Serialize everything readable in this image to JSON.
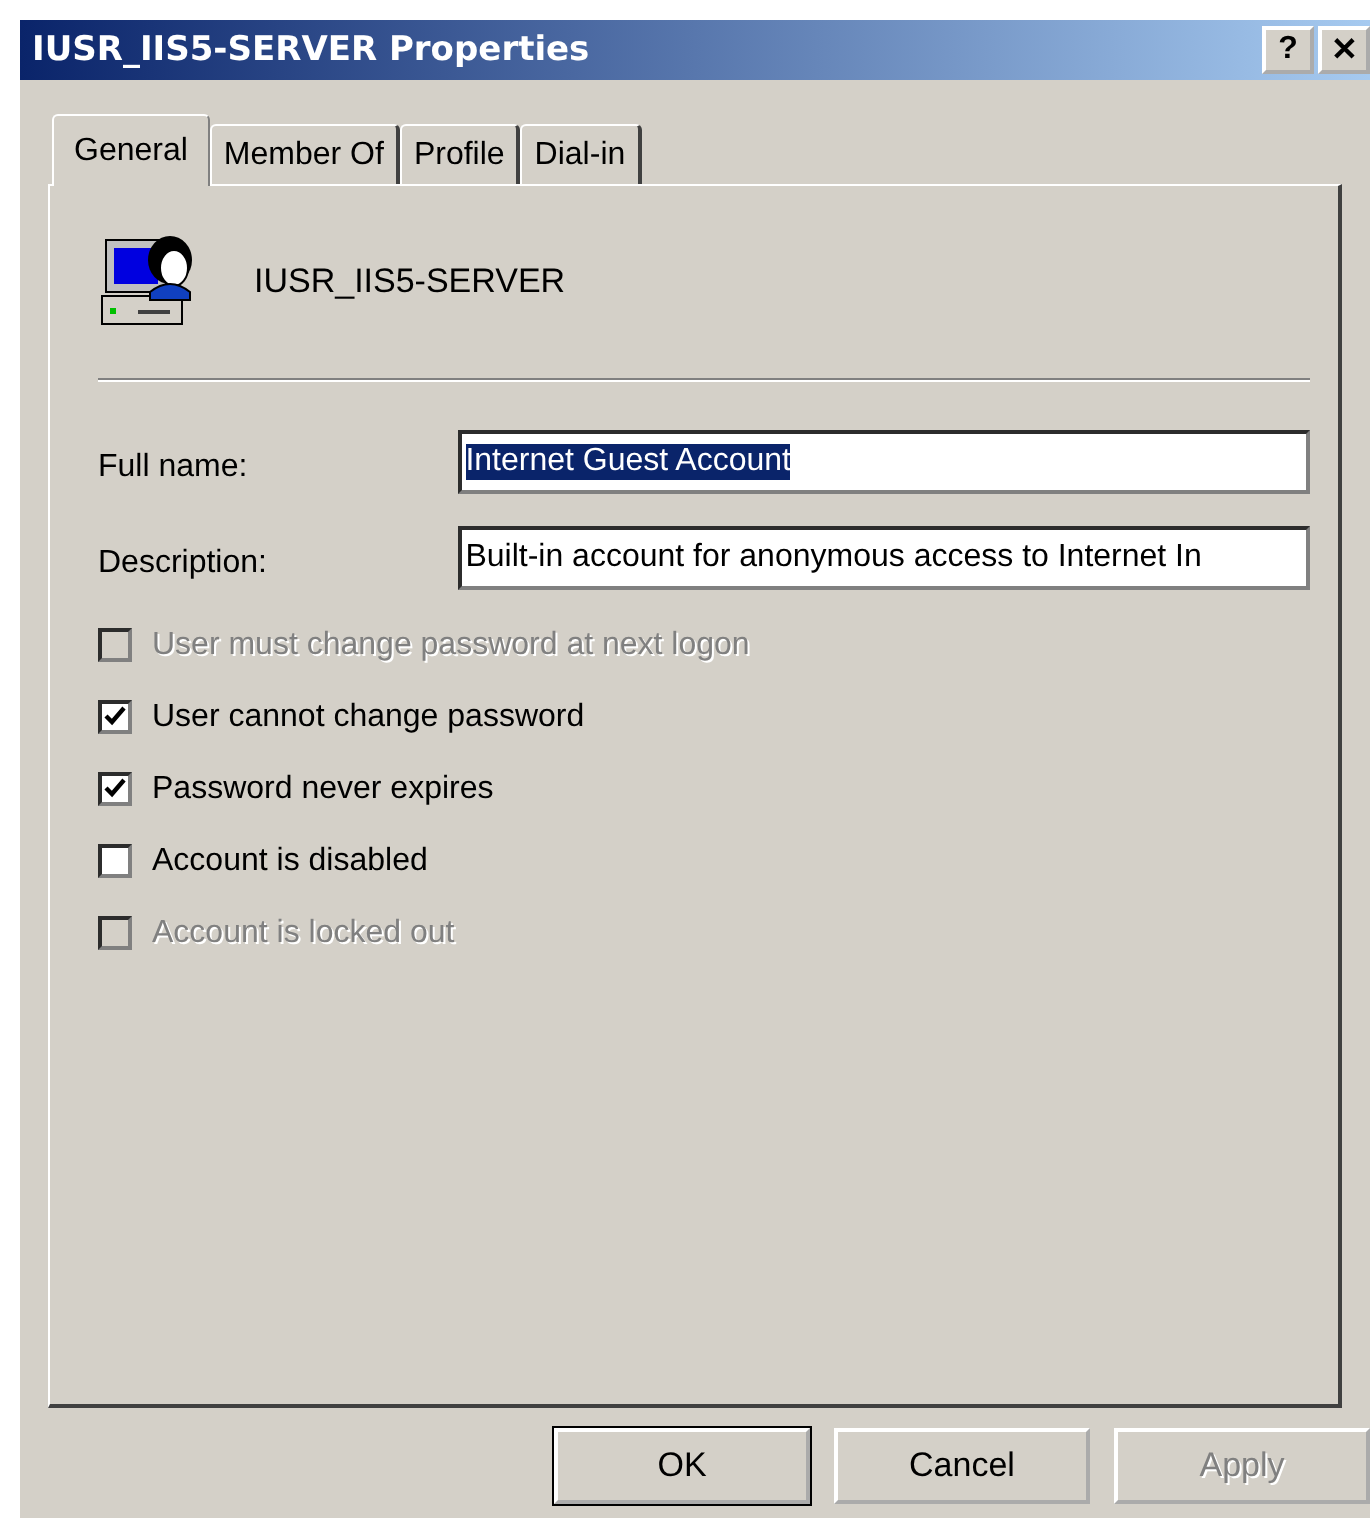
{
  "window": {
    "title": "IUSR_IIS5-SERVER Properties",
    "title_buttons": [
      "?",
      "✕"
    ]
  },
  "tabs": [
    {
      "label": "General",
      "selected": true
    },
    {
      "label": "Member Of",
      "selected": false
    },
    {
      "label": "Profile",
      "selected": false
    },
    {
      "label": "Dial-in",
      "selected": false
    }
  ],
  "account": {
    "name": "IUSR_IIS5-SERVER"
  },
  "fields": [
    {
      "label": "Full name:",
      "value": "Internet Guest Account",
      "selected": true
    },
    {
      "label": "Description:",
      "value": "Built-in account for anonymous access to Internet In",
      "selected": false
    }
  ],
  "checkboxes": [
    {
      "label": "User must change password at next logon",
      "checked": false,
      "disabled": true
    },
    {
      "label": "User cannot change password",
      "checked": true,
      "disabled": false
    },
    {
      "label": "Password never expires",
      "checked": true,
      "disabled": false
    },
    {
      "label": "Account is disabled",
      "checked": false,
      "disabled": false
    },
    {
      "label": "Account is locked out",
      "checked": false,
      "disabled": true
    }
  ],
  "buttons": [
    {
      "label": "OK",
      "default": true,
      "disabled": false
    },
    {
      "label": "Cancel",
      "default": false,
      "disabled": false
    },
    {
      "label": "Apply",
      "default": false,
      "disabled": true
    }
  ]
}
